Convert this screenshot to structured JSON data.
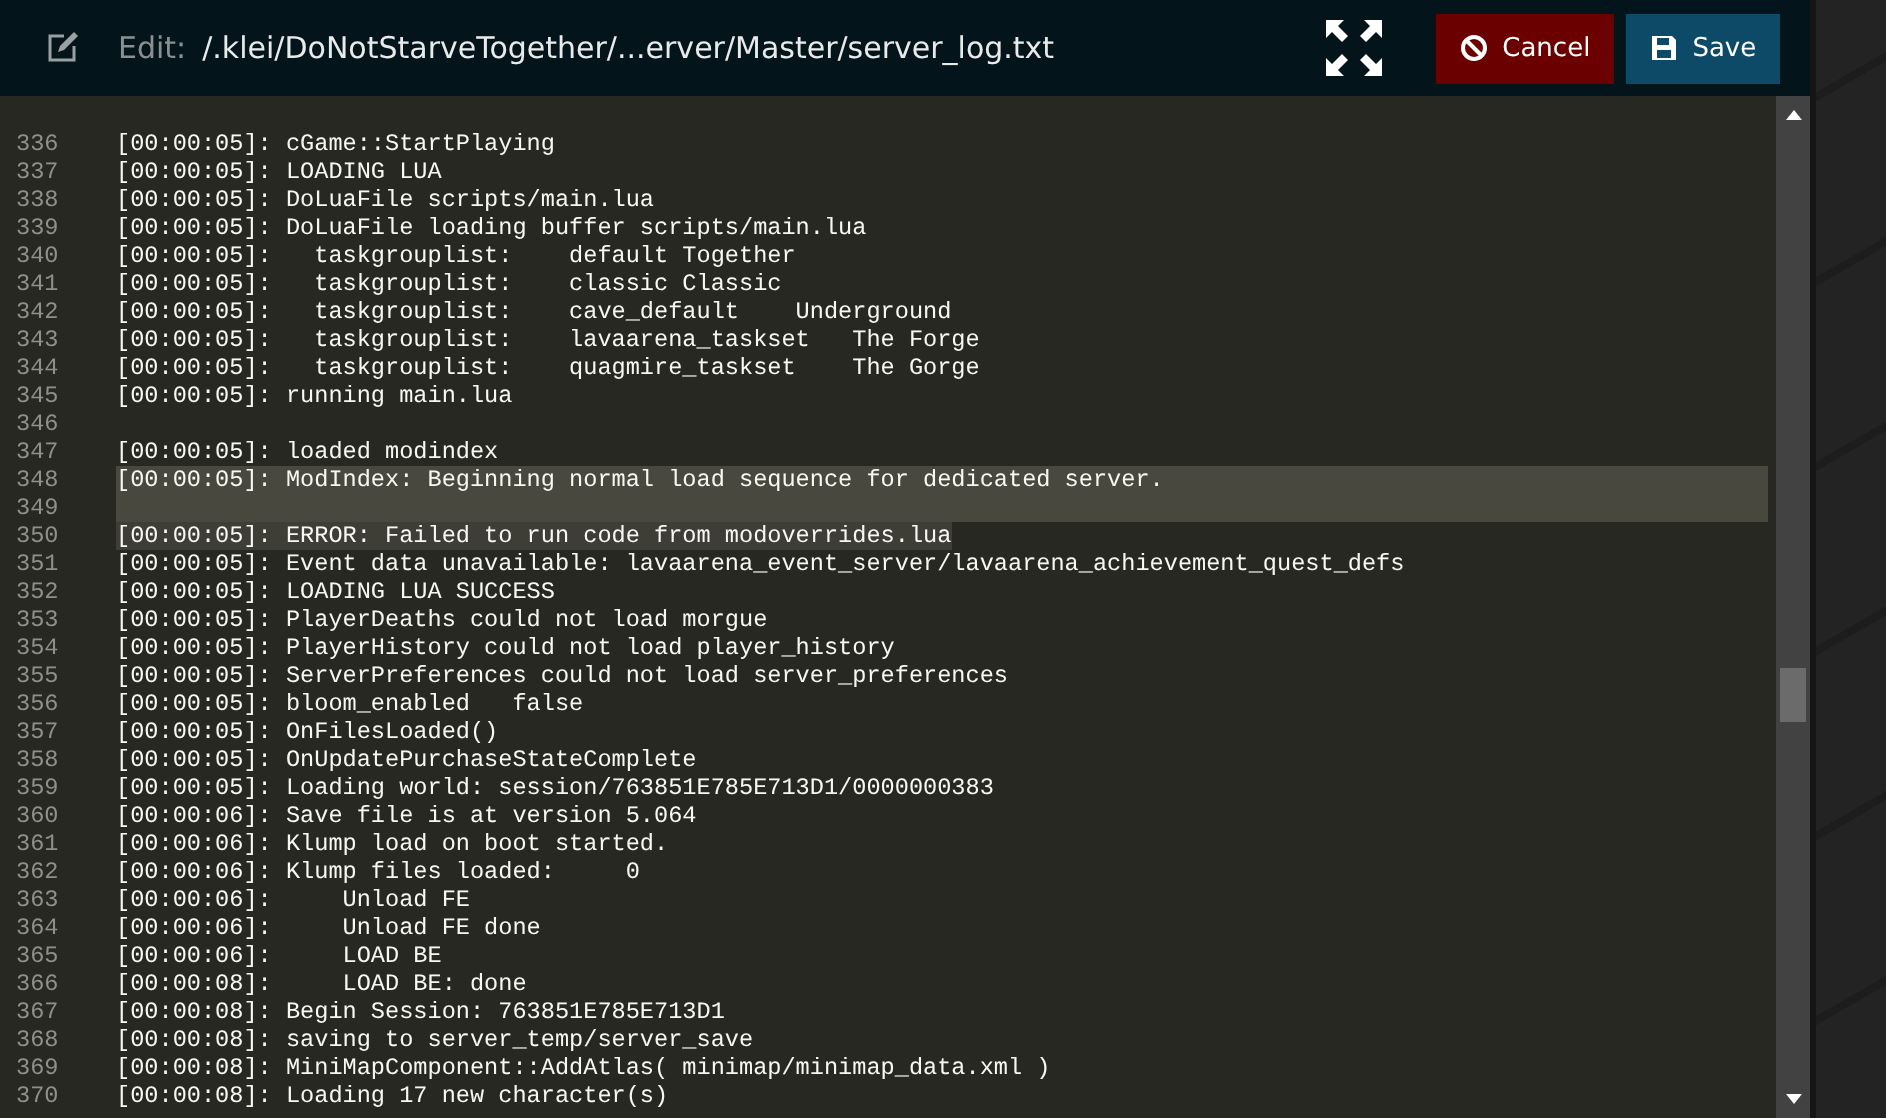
{
  "header": {
    "label": "Edit:",
    "path": "/.klei/DoNotStarveTogether/...erver/Master/server_log.txt",
    "buttons": [
      {
        "label": "Cancel",
        "kind": "cancel"
      },
      {
        "label": "Save",
        "kind": "save"
      }
    ]
  },
  "editor": {
    "lines": [
      {
        "number": "336",
        "text": "[00:00:05]: cGame::StartPlaying",
        "selected": false
      },
      {
        "number": "337",
        "text": "[00:00:05]: LOADING LUA",
        "selected": false
      },
      {
        "number": "338",
        "text": "[00:00:05]: DoLuaFile scripts/main.lua",
        "selected": false
      },
      {
        "number": "339",
        "text": "[00:00:05]: DoLuaFile loading buffer scripts/main.lua",
        "selected": false
      },
      {
        "number": "340",
        "text": "[00:00:05]:   taskgrouplist:    default Together",
        "selected": false
      },
      {
        "number": "341",
        "text": "[00:00:05]:   taskgrouplist:    classic Classic",
        "selected": false
      },
      {
        "number": "342",
        "text": "[00:00:05]:   taskgrouplist:    cave_default    Underground",
        "selected": false
      },
      {
        "number": "343",
        "text": "[00:00:05]:   taskgrouplist:    lavaarena_taskset   The Forge",
        "selected": false
      },
      {
        "number": "344",
        "text": "[00:00:05]:   taskgrouplist:    quagmire_taskset    The Gorge",
        "selected": false
      },
      {
        "number": "345",
        "text": "[00:00:05]: running main.lua",
        "selected": false
      },
      {
        "number": "346",
        "selected": false
      },
      {
        "number": "347",
        "text": "[00:00:05]: loaded modindex",
        "selected": false
      },
      {
        "number": "348",
        "text": "[00:00:05]: ModIndex: Beginning normal load sequence for dedicated server.",
        "selected": true
      },
      {
        "number": "349",
        "selected": true
      },
      {
        "number": "350",
        "text": "[00:00:05]: ERROR: Failed to run code from modoverrides.lua",
        "selected": true
      },
      {
        "number": "351",
        "text": "[00:00:05]: Event data unavailable: lavaarena_event_server/lavaarena_achievement_quest_defs",
        "selected": false
      },
      {
        "number": "352",
        "text": "[00:00:05]: LOADING LUA SUCCESS",
        "selected": false
      },
      {
        "number": "353",
        "text": "[00:00:05]: PlayerDeaths could not load morgue",
        "selected": false
      },
      {
        "number": "354",
        "text": "[00:00:05]: PlayerHistory could not load player_history",
        "selected": false
      },
      {
        "number": "355",
        "text": "[00:00:05]: ServerPreferences could not load server_preferences",
        "selected": false
      },
      {
        "number": "356",
        "text": "[00:00:05]: bloom_enabled   false",
        "selected": false
      },
      {
        "number": "357",
        "text": "[00:00:05]: OnFilesLoaded()",
        "selected": false
      },
      {
        "number": "358",
        "text": "[00:00:05]: OnUpdatePurchaseStateComplete",
        "selected": false
      },
      {
        "number": "359",
        "text": "[00:00:05]: Loading world: session/763851E785E713D1/0000000383",
        "selected": false
      },
      {
        "number": "360",
        "text": "[00:00:06]: Save file is at version 5.064",
        "selected": false
      },
      {
        "number": "361",
        "text": "[00:00:06]: Klump load on boot started.",
        "selected": false
      },
      {
        "number": "362",
        "text": "[00:00:06]: Klump files loaded:     0",
        "selected": false
      },
      {
        "number": "363",
        "text": "[00:00:06]:     Unload FE",
        "selected": false
      },
      {
        "number": "364",
        "text": "[00:00:06]:     Unload FE done",
        "selected": false
      },
      {
        "number": "365",
        "text": "[00:00:06]:     LOAD BE",
        "selected": false
      },
      {
        "number": "366",
        "text": "[00:00:08]:     LOAD BE: done",
        "selected": false
      },
      {
        "number": "367",
        "text": "[00:00:08]: Begin Session: 763851E785E713D1",
        "selected": false
      },
      {
        "number": "368",
        "text": "[00:00:08]: saving to server_temp/server_save",
        "selected": false
      },
      {
        "number": "369",
        "text": "[00:00:08]: MiniMapComponent::AddAtlas( minimap/minimap_data.xml )",
        "selected": false
      },
      {
        "number": "370",
        "text": "[00:00:08]: Loading 17 new character(s)",
        "selected": false
      }
    ]
  }
}
